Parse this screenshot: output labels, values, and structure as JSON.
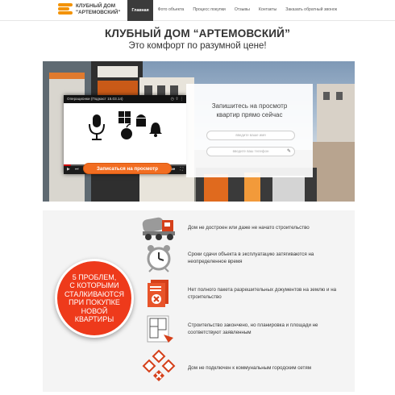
{
  "header": {
    "logo_line1": "КЛУБНЫЙ ДОМ",
    "logo_line2": "\"АРТЕМОВСКИЙ\"",
    "nav": [
      {
        "label": "Главная",
        "active": true
      },
      {
        "label": "Фото объекта",
        "active": false
      },
      {
        "label": "Процесс покупки",
        "active": false
      },
      {
        "label": "Отзывы",
        "active": false
      },
      {
        "label": "Контакты",
        "active": false
      },
      {
        "label": "Заказать обратный звонок",
        "active": false
      }
    ]
  },
  "hero": {
    "title": "КЛУБНЫЙ ДОМ “АРТЕМОВСКИЙ”",
    "subtitle": "Это комфорт по разумной цене!"
  },
  "video": {
    "title": "Операционки (Подкаст 15.03.14)",
    "current_time": "0:00",
    "duration": "20:35",
    "logo": "YouTube",
    "progress_fraction": 0.06
  },
  "form": {
    "heading_line1": "Запишитесь на просмотр",
    "heading_line2": "квартир прямо сейчас",
    "name_placeholder": "введите ваше имя",
    "phone_placeholder": "введите ваш телефон",
    "submit_label": "Записаться на просмотр"
  },
  "problems": {
    "badge_text": "5 ПРОБЛЕМ,\nС КОТОРЫМИ\nСТАЛКИВАЮТСЯ\nПРИ ПОКУПКЕ\nНОВОЙ\nКВАРТИРЫ",
    "items": [
      {
        "icon": "concrete-mixer-icon",
        "text": "Дом не достроен или даже не начато строительство"
      },
      {
        "icon": "alarm-clock-icon",
        "text": "Сроки сдачи объекта в эксплуатацию затягиваются на неопределенное время"
      },
      {
        "icon": "documents-icon",
        "text": "Нет полного пакета разрешительных документов на землю и на строительство"
      },
      {
        "icon": "floor-plan-icon",
        "text": "Строительство закончено, но планировка и площади не соответствуют заявленным"
      },
      {
        "icon": "utilities-icon",
        "text": "Дом не подключен к коммунальным городским сетям"
      }
    ]
  },
  "colors": {
    "accent": "#f26d21",
    "badge_red": "#ee3a1b",
    "nav_active": "#3b3b3b"
  }
}
